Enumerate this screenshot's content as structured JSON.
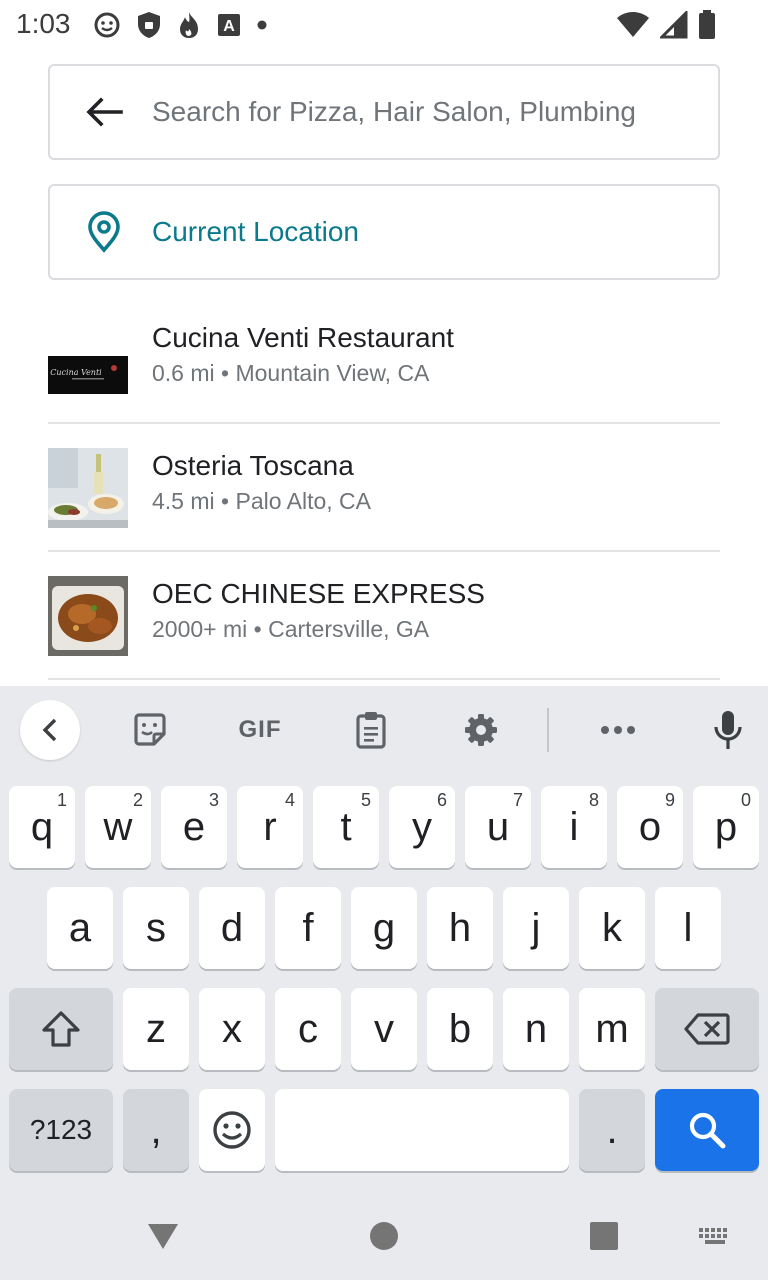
{
  "status_bar": {
    "time": "1:03"
  },
  "search": {
    "placeholder": "Search for Pizza, Hair Salon, Plumbing",
    "value": ""
  },
  "location": {
    "label": "Current Location",
    "accent_color": "#0b7a8c"
  },
  "results": [
    {
      "name": "Cucina Venti Restaurant",
      "distance": "0.6 mi",
      "separator": "•",
      "place": "Mountain View, CA",
      "thumb_text": "Cucina Venti"
    },
    {
      "name": "Osteria Toscana",
      "distance": "4.5 mi",
      "separator": "•",
      "place": "Palo Alto, CA"
    },
    {
      "name": "OEC CHINESE EXPRESS",
      "distance": "2000+ mi",
      "separator": "•",
      "place": "Cartersville, GA"
    }
  ],
  "keyboard": {
    "toolbar": {
      "gif_label": "GIF",
      "icons": [
        "chevron-left-icon",
        "sticker-icon",
        "gif-icon",
        "clipboard-icon",
        "gear-icon",
        "more-icon",
        "microphone-icon"
      ]
    },
    "row1": [
      {
        "char": "q",
        "hint": "1"
      },
      {
        "char": "w",
        "hint": "2"
      },
      {
        "char": "e",
        "hint": "3"
      },
      {
        "char": "r",
        "hint": "4"
      },
      {
        "char": "t",
        "hint": "5"
      },
      {
        "char": "y",
        "hint": "6"
      },
      {
        "char": "u",
        "hint": "7"
      },
      {
        "char": "i",
        "hint": "8"
      },
      {
        "char": "o",
        "hint": "9"
      },
      {
        "char": "p",
        "hint": "0"
      }
    ],
    "row2": [
      "a",
      "s",
      "d",
      "f",
      "g",
      "h",
      "j",
      "k",
      "l"
    ],
    "row3": [
      "z",
      "x",
      "c",
      "v",
      "b",
      "n",
      "m"
    ],
    "symbols_label": "?123",
    "comma": ",",
    "period": ".",
    "action_color": "#1a73e8"
  }
}
